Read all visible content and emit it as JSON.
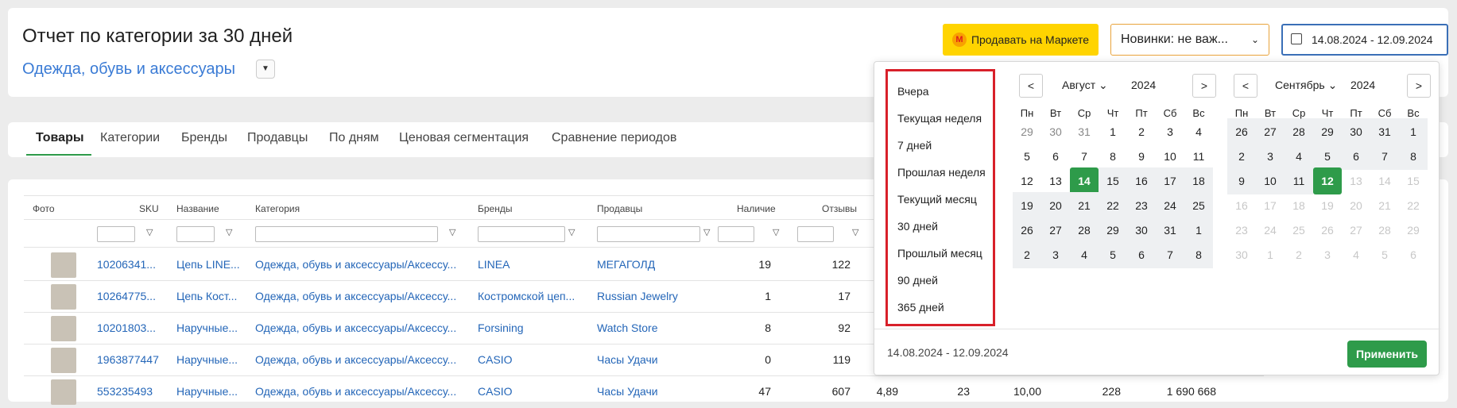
{
  "header": {
    "title": "Отчет по категории за 30 дней",
    "category": "Одежда, обувь и аксессуары",
    "sell_label": "Продавать на Маркете",
    "sell_logo": "M",
    "news_label": "Новинки: не важ...",
    "date_value": "14.08.2024 - 12.09.2024"
  },
  "tabs": [
    "Товары",
    "Категории",
    "Бренды",
    "Продавцы",
    "По дням",
    "Ценовая сегментация",
    "Сравнение периодов"
  ],
  "table": {
    "columns": [
      "Фото",
      "SKU",
      "Название",
      "Категория",
      "Бренды",
      "Продавцы",
      "Наличие",
      "Отзывы"
    ],
    "rows": [
      {
        "sku": "10206341...",
        "name": "Цепь LINE...",
        "category": "Одежда, обувь и аксессуары/Аксессу...",
        "brand": "LINEA",
        "seller": "МЕГАГОЛД",
        "stock": "19",
        "reviews": "122"
      },
      {
        "sku": "10264775...",
        "name": "Цепь Кост...",
        "category": "Одежда, обувь и аксессуары/Аксессу...",
        "brand": "Костромской цеп...",
        "seller": "Russian Jewelry",
        "stock": "1",
        "reviews": "17"
      },
      {
        "sku": "10201803...",
        "name": "Наручные...",
        "category": "Одежда, обувь и аксессуары/Аксессу...",
        "brand": "Forsining",
        "seller": "Watch Store",
        "stock": "8",
        "reviews": "92"
      },
      {
        "sku": "1963877447",
        "name": "Наручные...",
        "category": "Одежда, обувь и аксессуары/Аксессу...",
        "brand": "CASIO",
        "seller": "Часы Удачи",
        "stock": "0",
        "reviews": "119"
      },
      {
        "sku": "553235493",
        "name": "Наручные...",
        "category": "Одежда, обувь и аксессуары/Аксессу...",
        "brand": "CASIO",
        "seller": "Часы Удачи",
        "stock": "47",
        "reviews": "607"
      }
    ],
    "extra_row5": [
      "4,89",
      "23",
      "10,00",
      "228",
      "1 690 668"
    ]
  },
  "datepicker": {
    "presets": [
      "Вчера",
      "Текущая неделя",
      "7 дней",
      "Прошлая неделя",
      "Текущий месяц",
      "30 дней",
      "Прошлый месяц",
      "90 дней",
      "365 дней"
    ],
    "weekdays": [
      "Пн",
      "Вт",
      "Ср",
      "Чт",
      "Пт",
      "Сб",
      "Вс"
    ],
    "left_month": {
      "month": "Август",
      "year": "2024",
      "days": [
        [
          "29",
          "30",
          "31",
          "1",
          "2",
          "3",
          "4"
        ],
        [
          "5",
          "6",
          "7",
          "8",
          "9",
          "10",
          "11"
        ],
        [
          "12",
          "13",
          "14",
          "15",
          "16",
          "17",
          "18"
        ],
        [
          "19",
          "20",
          "21",
          "22",
          "23",
          "24",
          "25"
        ],
        [
          "26",
          "27",
          "28",
          "29",
          "30",
          "31",
          "1"
        ],
        [
          "2",
          "3",
          "4",
          "5",
          "6",
          "7",
          "8"
        ]
      ]
    },
    "right_month": {
      "month": "Сентябрь",
      "year": "2024",
      "days": [
        [
          "26",
          "27",
          "28",
          "29",
          "30",
          "31",
          "1"
        ],
        [
          "2",
          "3",
          "4",
          "5",
          "6",
          "7",
          "8"
        ],
        [
          "9",
          "10",
          "11",
          "12",
          "13",
          "14",
          "15"
        ],
        [
          "16",
          "17",
          "18",
          "19",
          "20",
          "21",
          "22"
        ],
        [
          "23",
          "24",
          "25",
          "26",
          "27",
          "28",
          "29"
        ],
        [
          "30",
          "1",
          "2",
          "3",
          "4",
          "5",
          "6"
        ]
      ]
    },
    "range_text": "14.08.2024 - 12.09.2024",
    "apply_label": "Применить"
  }
}
